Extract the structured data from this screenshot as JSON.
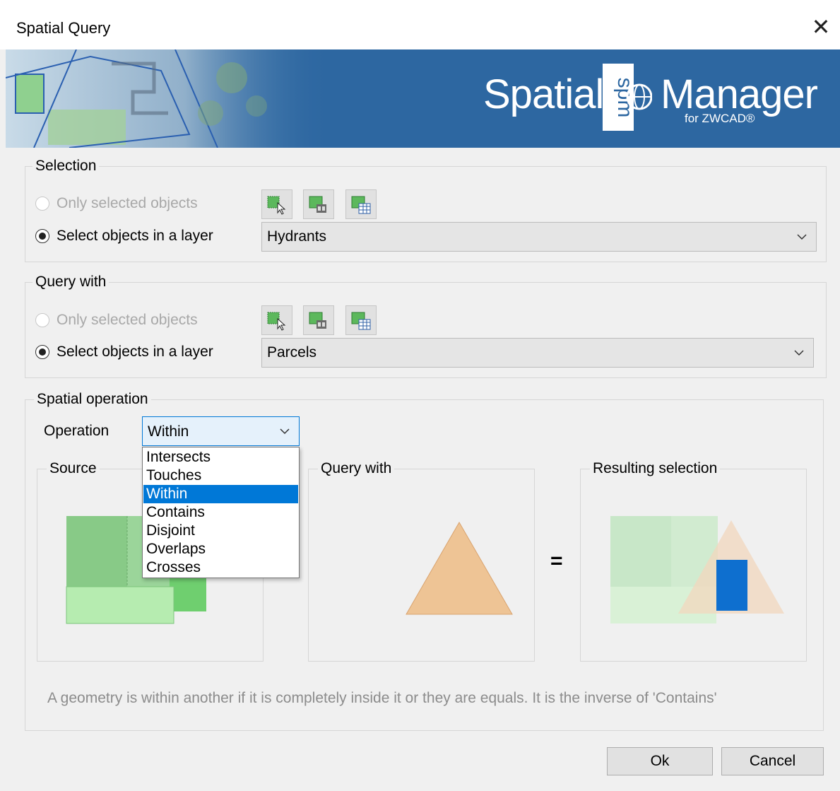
{
  "window": {
    "title": "Spatial Query",
    "close_glyph": "✕"
  },
  "banner": {
    "brand_left": "Spatial",
    "brand_logo_text": "spm",
    "brand_right": "Manager",
    "brand_sub": "for ZWCAD®",
    "background_color": "#2d67a1"
  },
  "selection": {
    "legend": "Selection",
    "option_selected_objects": "Only selected objects",
    "option_layer": "Select objects in a layer",
    "layer_value": "Hydrants",
    "tool_icons": [
      "select-objects-icon",
      "select-by-attributes-icon",
      "select-from-table-icon"
    ]
  },
  "query_with": {
    "legend": "Query with",
    "option_selected_objects": "Only selected objects",
    "option_layer": "Select objects in a layer",
    "layer_value": "Parcels",
    "tool_icons": [
      "select-objects-icon",
      "select-by-attributes-icon",
      "select-from-table-icon"
    ]
  },
  "spatial_operation": {
    "legend": "Spatial operation",
    "operation_label": "Operation",
    "operation_value": "Within",
    "options": [
      "Intersects",
      "Touches",
      "Within",
      "Contains",
      "Disjoint",
      "Overlaps",
      "Crosses"
    ],
    "selected_index": 2,
    "source_label": "Source",
    "query_with_label": "Query with",
    "result_label": "Resulting selection",
    "equals_sign": "=",
    "description": "A geometry is within another if it is completely inside it or they are equals. It is the inverse of 'Contains'"
  },
  "buttons": {
    "ok": "Ok",
    "cancel": "Cancel"
  }
}
